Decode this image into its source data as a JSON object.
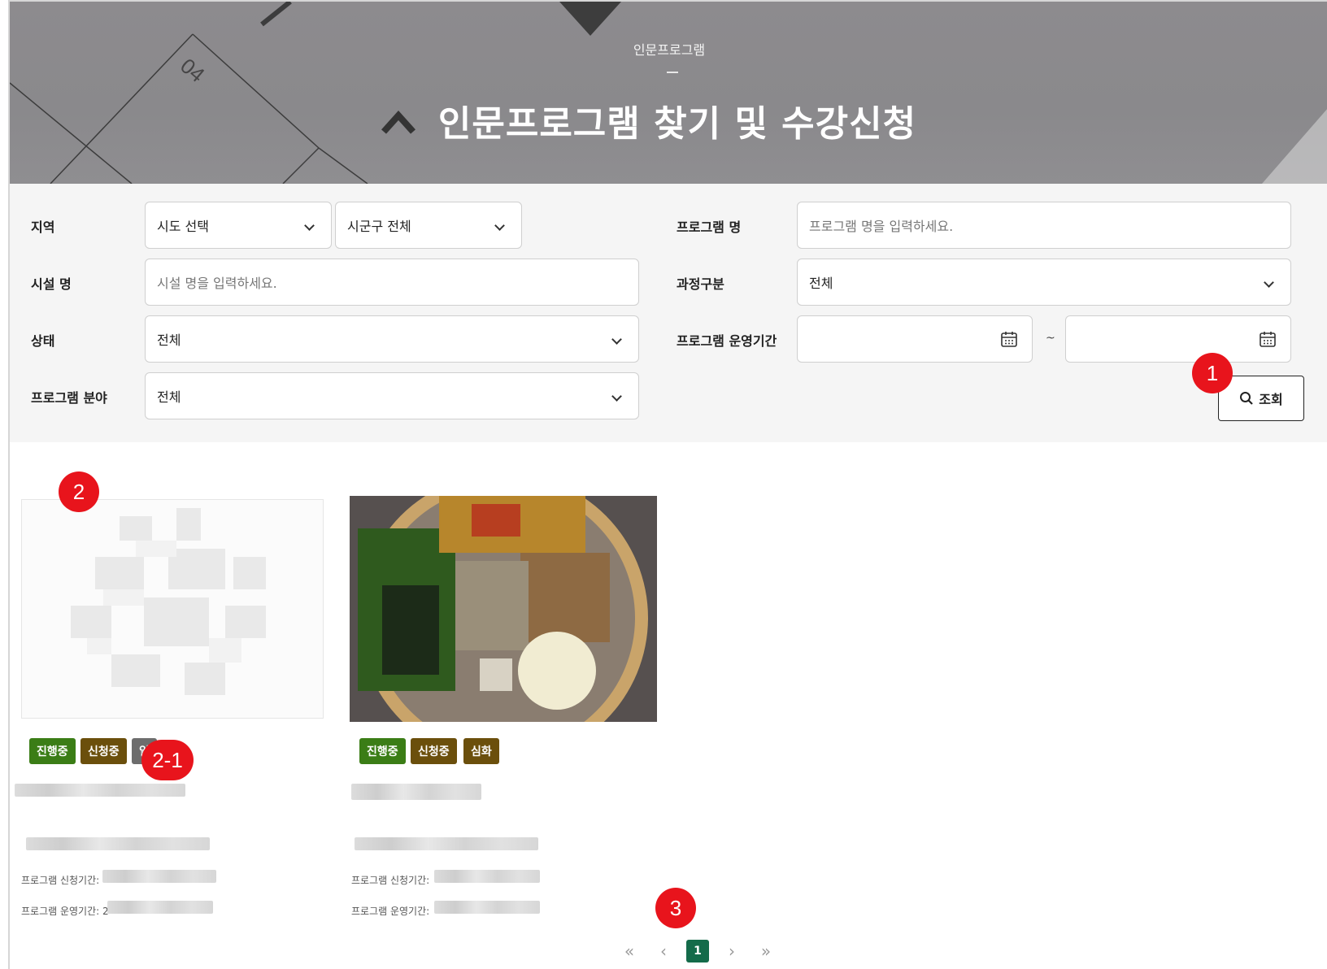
{
  "hero": {
    "eyebrow": "인문프로그램",
    "title": "인문프로그램 찾기 및 수강신청"
  },
  "search": {
    "region_label": "지역",
    "sido_value": "시도 선택",
    "sigungu_value": "시군구 전체",
    "program_name_label": "프로그램 명",
    "program_name_placeholder": "프로그램 명을 입력하세요.",
    "facility_label": "시설 명",
    "facility_placeholder": "시설 명을 입력하세요.",
    "course_label": "과정구분",
    "course_value": "전체",
    "status_label": "상태",
    "status_value": "전체",
    "period_label": "프로그램 운영기간",
    "period_separator": "~",
    "field_label": "프로그램 분야",
    "field_value": "전체",
    "search_button": "조회"
  },
  "markers": {
    "m1": "1",
    "m2": "2",
    "m2_1": "2-1",
    "m3": "3"
  },
  "cards": [
    {
      "tags": [
        "진행중",
        "신청중",
        "일"
      ],
      "apply_period_label": "프로그램 신청기간:",
      "run_period_label": "프로그램 운영기간: 2"
    },
    {
      "tags": [
        "진행중",
        "신청중",
        "심화"
      ],
      "apply_period_label": "프로그램 신청기간:",
      "run_period_label": "프로그램 운영기간:"
    }
  ],
  "pagination": {
    "first": "«",
    "prev": "‹",
    "current": "1",
    "next": "›",
    "last": "»"
  },
  "icons": {
    "search": "search-icon",
    "calendar": "calendar-icon",
    "chevron": "chevron-down-icon"
  },
  "colors": {
    "marker": "#e8141c",
    "tag_green": "#3b7d16",
    "tag_olive": "#6b4f0c",
    "pager_active": "#146b4a"
  }
}
